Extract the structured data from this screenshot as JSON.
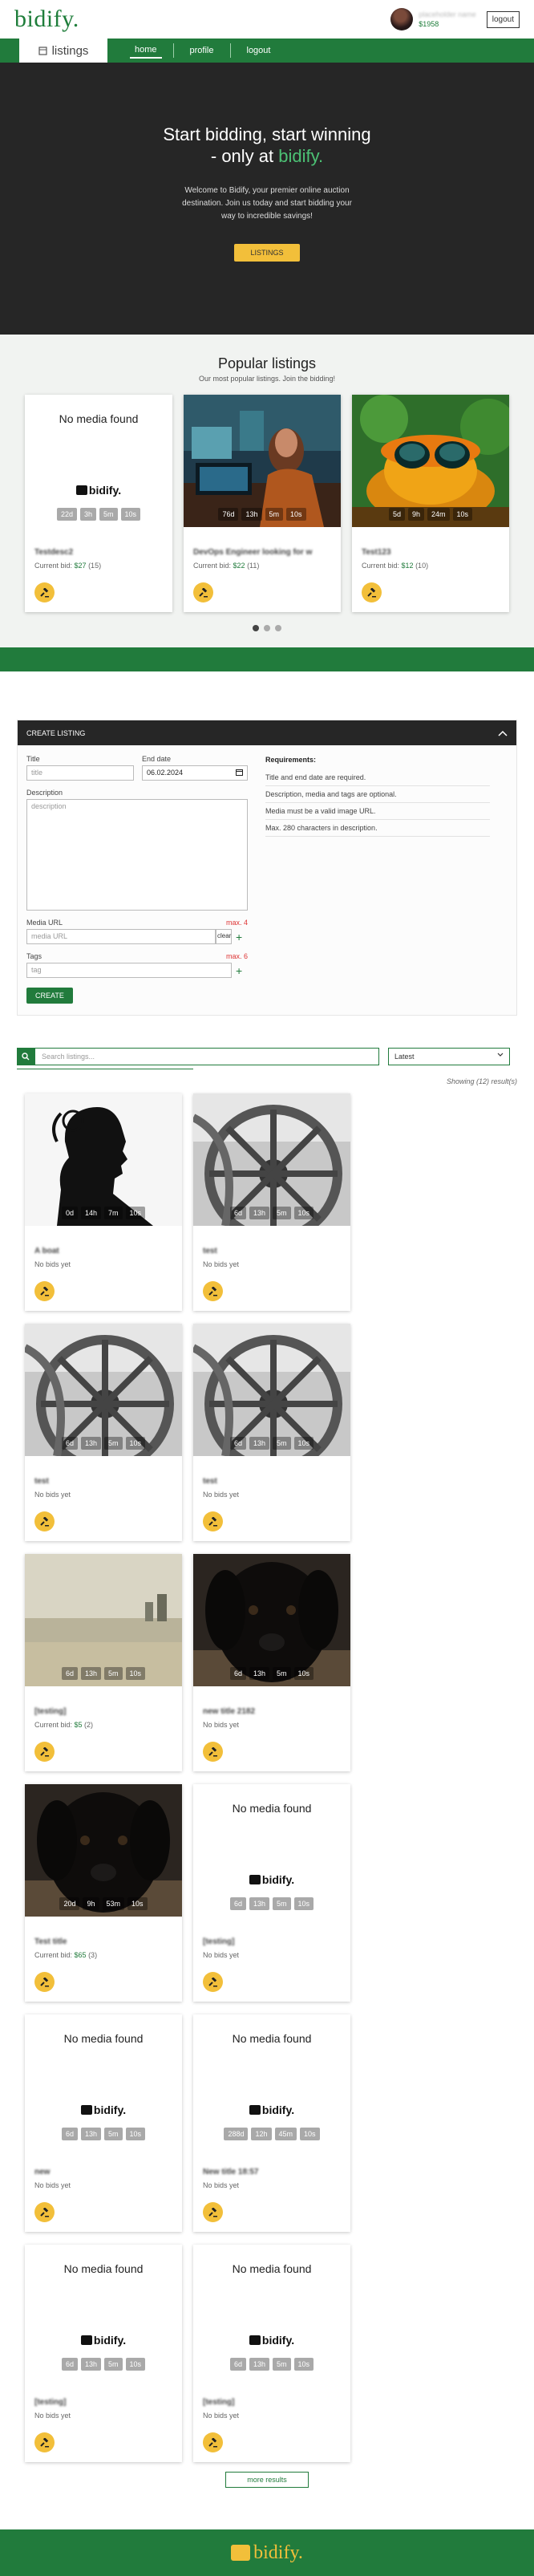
{
  "header": {
    "brand": "bidify.",
    "username": "placeholder name",
    "credits": "$1958",
    "logout": "logout"
  },
  "nav": {
    "tab": "listings",
    "links": [
      "home",
      "profile",
      "logout"
    ]
  },
  "hero": {
    "title_line1": "Start bidding, start winning",
    "title_line2_pre": "- only at ",
    "title_line2_accent": "bidify.",
    "text": "Welcome to Bidify, your premier online auction destination. Join us today and start bidding your way to incredible savings!",
    "button": "LISTINGS"
  },
  "popular": {
    "title": "Popular listings",
    "subtitle": "Our most popular listings. Join the bidding!",
    "cards": [
      {
        "media": "none",
        "nomedia": "No media found",
        "logo": "bidify.",
        "timer": [
          "22d",
          "3h",
          "5m",
          "10s"
        ],
        "title": "Testdesc2",
        "bid": "Current bid: ",
        "amount": "$27",
        "count": " (15)"
      },
      {
        "media": "woman",
        "timer": [
          "76d",
          "13h",
          "5m",
          "10s"
        ],
        "title": "DevOps Engineer looking for w",
        "bid": "Current bid: ",
        "amount": "$22",
        "count": " (11)"
      },
      {
        "media": "frog",
        "timer": [
          "5d",
          "9h",
          "24m",
          "10s"
        ],
        "title": "Test123",
        "bid": "Current bid: ",
        "amount": "$12",
        "count": " (10)"
      }
    ]
  },
  "create": {
    "header": "CREATE LISTING",
    "title_label": "Title",
    "title_ph": "title",
    "date_label": "End date",
    "date_val": "06.02.2024",
    "desc_label": "Description",
    "desc_ph": "description",
    "media_label": "Media URL",
    "media_max": "max. 4",
    "media_ph": "media URL",
    "clear": "clear",
    "tags_label": "Tags",
    "tags_max": "max. 6",
    "tags_ph": "tag",
    "button": "CREATE",
    "req_title": "Requirements:",
    "reqs": [
      "Title and end date are required.",
      "Description, media and tags are optional.",
      "Media must be a valid image URL.",
      "Max. 280 characters in description."
    ]
  },
  "search": {
    "placeholder": "Search listings...",
    "sort": "Latest",
    "showing": "Showing (12) result(s)",
    "more": "more results"
  },
  "listings": [
    {
      "media": "silhouette",
      "timer": [
        "0d",
        "14h",
        "7m",
        "10s"
      ],
      "title": "A boat",
      "bid": "No bids yet"
    },
    {
      "media": "wheel",
      "timer": [
        "6d",
        "13h",
        "5m",
        "10s"
      ],
      "title": "test",
      "bid": "No bids yet"
    },
    {
      "media": "wheel",
      "timer": [
        "6d",
        "13h",
        "5m",
        "10s"
      ],
      "title": "test",
      "bid": "No bids yet"
    },
    {
      "media": "wheel",
      "timer": [
        "6d",
        "13h",
        "5m",
        "10s"
      ],
      "title": "test",
      "bid": "No bids yet"
    },
    {
      "media": "beach",
      "timer": [
        "6d",
        "13h",
        "5m",
        "10s"
      ],
      "title": "[testing]",
      "bid": "Current bid: ",
      "amount": "$5",
      "count": " (2)"
    },
    {
      "media": "dog",
      "timer": [
        "6d",
        "13h",
        "5m",
        "10s"
      ],
      "title": "new title 2182",
      "bid": "No bids yet"
    },
    {
      "media": "dog",
      "timer": [
        "20d",
        "9h",
        "53m",
        "10s"
      ],
      "title": "Test title",
      "bid": "Current bid: ",
      "amount": "$65",
      "count": " (3)"
    },
    {
      "media": "none",
      "nomedia": "No media found",
      "logo": "bidify.",
      "timer": [
        "6d",
        "13h",
        "5m",
        "10s"
      ],
      "title": "[testing]",
      "bid": "No bids yet"
    },
    {
      "media": "none",
      "nomedia": "No media found",
      "logo": "bidify.",
      "timer": [
        "6d",
        "13h",
        "5m",
        "10s"
      ],
      "title": "new",
      "bid": "No bids yet"
    },
    {
      "media": "none",
      "nomedia": "No media found",
      "logo": "bidify.",
      "timer": [
        "288d",
        "12h",
        "45m",
        "10s"
      ],
      "title": "New title 18:57",
      "bid": "No bids yet"
    },
    {
      "media": "none",
      "nomedia": "No media found",
      "logo": "bidify.",
      "timer": [
        "6d",
        "13h",
        "5m",
        "10s"
      ],
      "title": "[testing]",
      "bid": "No bids yet"
    },
    {
      "media": "none",
      "nomedia": "No media found",
      "logo": "bidify.",
      "timer": [
        "6d",
        "13h",
        "5m",
        "10s"
      ],
      "title": "[testing]",
      "bid": "No bids yet"
    }
  ],
  "footer": {
    "logo": "bidify."
  }
}
